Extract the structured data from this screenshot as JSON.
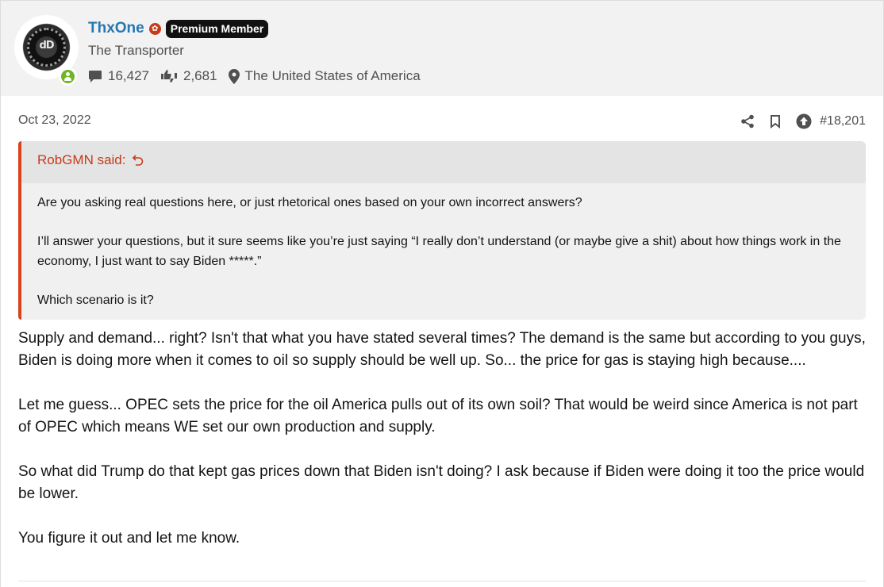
{
  "user": {
    "name": "ThxOne",
    "badge": "Premium Member",
    "title": "The Transporter",
    "messages_count": "16,427",
    "reaction_score": "2,681",
    "location": "The United States of America",
    "online": true,
    "avatar_text": "dD"
  },
  "post": {
    "date": "Oct 23, 2022",
    "number": "#18,201",
    "actions": [
      "share-icon",
      "bookmark-icon",
      "upvote-icon"
    ]
  },
  "quote": {
    "author": "RobGMN said:",
    "paragraphs": [
      "Are you asking real questions here, or just rhetorical ones based on your own incorrect answers?",
      "I’ll answer your questions, but it sure seems like you’re just saying “I really don’t understand (or maybe give a shit) about how things work in the economy, I just want to say Biden *****.”",
      "Which scenario is it?"
    ]
  },
  "message": {
    "paragraphs": [
      "Supply and demand... right? Isn't that what you have stated several times? The demand is the same but according to you guys, Biden is doing more when it comes to oil so supply should be well up. So... the price for gas is staying high because....",
      "Let me guess... OPEC sets the price for the oil America pulls out of its own soil? That would be weird since America is not part of OPEC which means WE set our own production and supply.",
      "So what did Trump do that kept gas prices down that Biden isn't doing? I ask because if Biden were doing it too the price would be lower.",
      "You figure it out and let me know."
    ]
  },
  "colors": {
    "username": "#2577b1",
    "quote_accent": "#d9421b",
    "online": "#6fb626"
  }
}
